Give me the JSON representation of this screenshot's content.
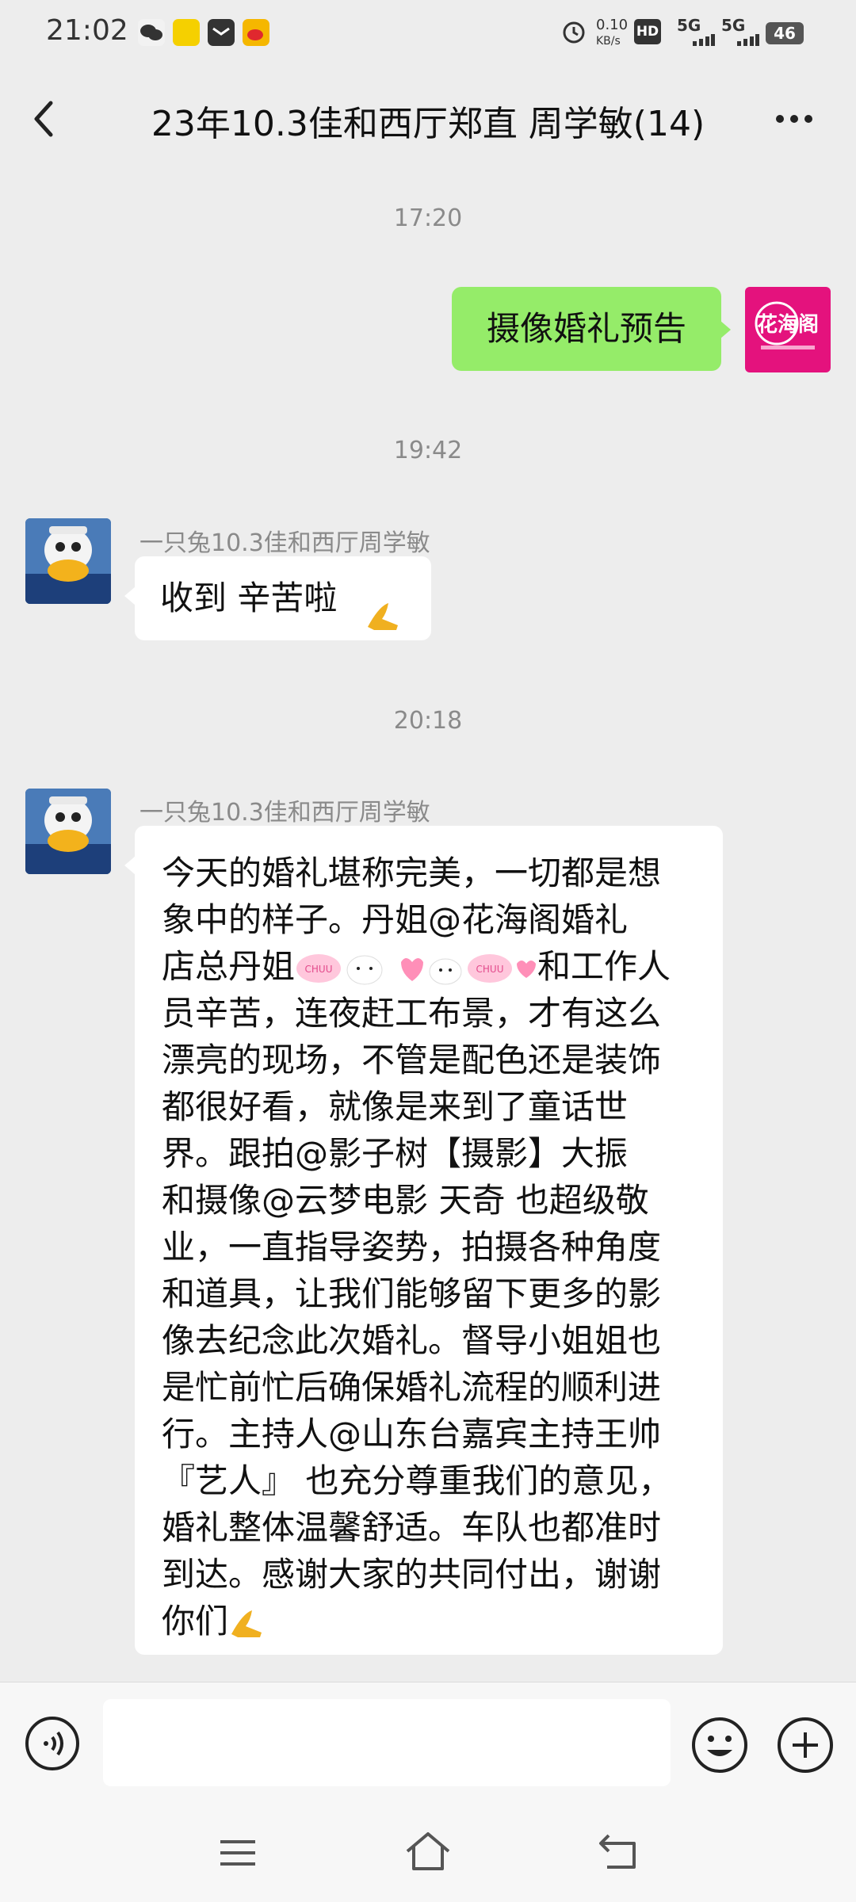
{
  "status_bar": {
    "time": "21:02",
    "net_speed": "0.10",
    "net_unit": "KB/s",
    "hd_label": "HD",
    "signal_1": "5G",
    "signal_2": "5G",
    "battery": "46"
  },
  "header": {
    "title": "23年10.3佳和西厅郑直 周学敏(14)"
  },
  "messages": [
    {
      "type": "time",
      "text": "17:20"
    },
    {
      "type": "self",
      "text": "摄像婚礼预告",
      "avatar_logo": "花海阁"
    },
    {
      "type": "time",
      "text": "19:42"
    },
    {
      "type": "other",
      "sender": "一只兔10.3佳和西厅周学敏",
      "text": "收到  辛苦啦"
    },
    {
      "type": "time",
      "text": "20:18"
    },
    {
      "type": "other",
      "sender": "一只兔10.3佳和西厅周学敏",
      "lines": [
        "今天的婚礼堪称完美，一切都是想",
        "象中的样子。丹姐@花海阁婚礼",
        "店总丹姐",
        "和工作人",
        "员辛苦，连夜赶工布景，才有这么",
        "漂亮的现场，不管是配色还是装饰",
        "都很好看，就像是来到了童话世",
        "界。跟拍@影子树【摄影】大振",
        "和摄像@云梦电影 天奇  也超级敬",
        "业，一直指导姿势，拍摄各种角度",
        "和道具，让我们能够留下更多的影",
        "像去纪念此次婚礼。督导小姐姐也",
        "是忙前忙后确保婚礼流程的顺利进",
        "行。主持人@山东台嘉宾主持王帅",
        "『艺人』 也充分尊重我们的意见，",
        "婚礼整体温馨舒适。车队也都准时",
        "到达。感谢大家的共同付出，谢谢",
        "你们"
      ],
      "sticker_text": "CHUU"
    }
  ],
  "colors": {
    "self_bubble": "#95ec69",
    "other_bubble": "#ffffff",
    "background": "#ededed",
    "logo_bg": "#e4127d"
  },
  "icons": [
    "back-arrow-icon",
    "more-icon",
    "voice-icon",
    "emoji-icon",
    "plus-icon",
    "menu-icon",
    "home-icon",
    "back-nav-icon",
    "pray-hands-icon"
  ]
}
